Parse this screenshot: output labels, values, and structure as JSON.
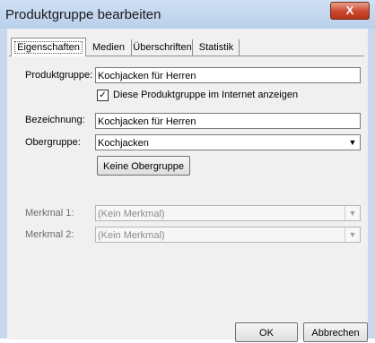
{
  "window": {
    "title": "Produktgruppe bearbeiten",
    "close_glyph": "X"
  },
  "tabs": [
    {
      "label": "Eigenschaften",
      "active": true
    },
    {
      "label": "Medien",
      "active": false
    },
    {
      "label": "Überschriften",
      "active": false
    },
    {
      "label": "Statistik",
      "active": false
    }
  ],
  "form": {
    "produktgruppe_label": "Produktgruppe:",
    "produktgruppe_value": "Kochjacken für Herren",
    "internet_checkbox_label": "Diese Produktgruppe im Internet anzeigen",
    "internet_checked": true,
    "bezeichnung_label": "Bezeichnung:",
    "bezeichnung_value": "Kochjacken für Herren",
    "obergruppe_label": "Obergruppe:",
    "obergruppe_value": "Kochjacken",
    "keine_obergruppe_button": "Keine Obergruppe",
    "merkmal1_label": "Merkmal 1:",
    "merkmal1_value": "(Kein Merkmal)",
    "merkmal2_label": "Merkmal 2:",
    "merkmal2_value": "(Kein Merkmal)"
  },
  "buttons": {
    "ok": "OK",
    "cancel": "Abbrechen"
  }
}
